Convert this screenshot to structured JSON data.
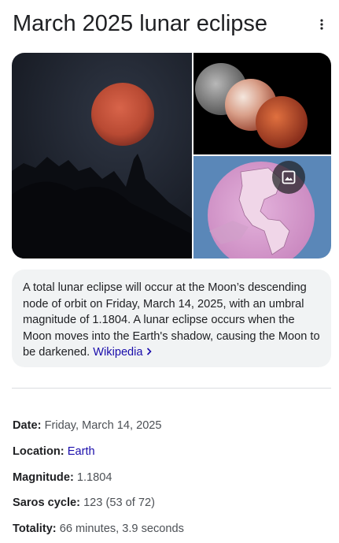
{
  "header": {
    "title": "March 2025 lunar eclipse",
    "more_icon": "more-vert-icon"
  },
  "gallery": {
    "images": [
      {
        "name": "red-moon-over-trees-photo"
      },
      {
        "name": "eclipse-phases-photo"
      },
      {
        "name": "eclipse-visibility-map"
      }
    ],
    "more_images_icon": "image-icon"
  },
  "description": {
    "text": "A total lunar eclipse will occur at the Moon’s descending node of orbit on Friday, March 14, 2025, with an umbral magnitude of 1.1804. A lunar eclipse occurs when the Moon moves into the Earth's shadow, causing the Moon to be darkened. ",
    "source_link": "Wikipedia",
    "source_icon": "chevron-right-icon"
  },
  "facts": [
    {
      "label": "Date:",
      "value": "Friday, March 14, 2025"
    },
    {
      "label": "Location:",
      "value": "Earth"
    },
    {
      "label": "Magnitude:",
      "value": "1.1804"
    },
    {
      "label": "Saros cycle:",
      "value": "123 (53 of 72)"
    },
    {
      "label": "Totality:",
      "value": "66 minutes, 3.9 seconds"
    }
  ]
}
